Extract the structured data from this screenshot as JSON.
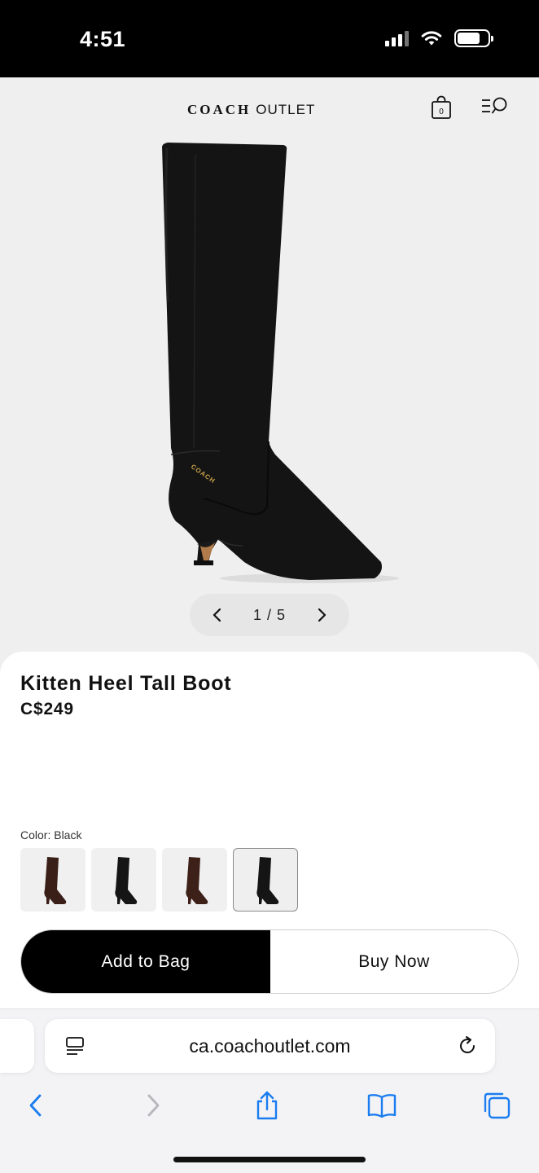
{
  "status_bar": {
    "time": "4:51"
  },
  "header": {
    "brand_name": "COACH",
    "brand_sub": "OUTLET",
    "bag_count": "0",
    "icons": [
      "shopping-bag-icon",
      "menu-search-icon"
    ]
  },
  "gallery": {
    "pager_text": "1 / 5",
    "current_index": 1,
    "total": 5,
    "image_logo_text": "COACH"
  },
  "product": {
    "title": "Kitten Heel Tall Boot",
    "price": "C$249",
    "color_label": "Color: Black",
    "swatches": [
      {
        "name": "brown",
        "color": "#3a1f18"
      },
      {
        "name": "black",
        "color": "#151515"
      },
      {
        "name": "brown",
        "color": "#3d2018"
      },
      {
        "name": "black",
        "color": "#151515",
        "selected": true
      }
    ]
  },
  "actions": {
    "add_to_bag": "Add to Bag",
    "buy_now": "Buy Now"
  },
  "browser": {
    "url": "ca.coachoutlet.com",
    "accent_color": "#1a7cf0",
    "disabled_color": "#b7b7bb",
    "toolbar_icons": [
      "back-icon",
      "forward-icon",
      "share-icon",
      "bookmarks-icon",
      "tabs-icon"
    ]
  }
}
